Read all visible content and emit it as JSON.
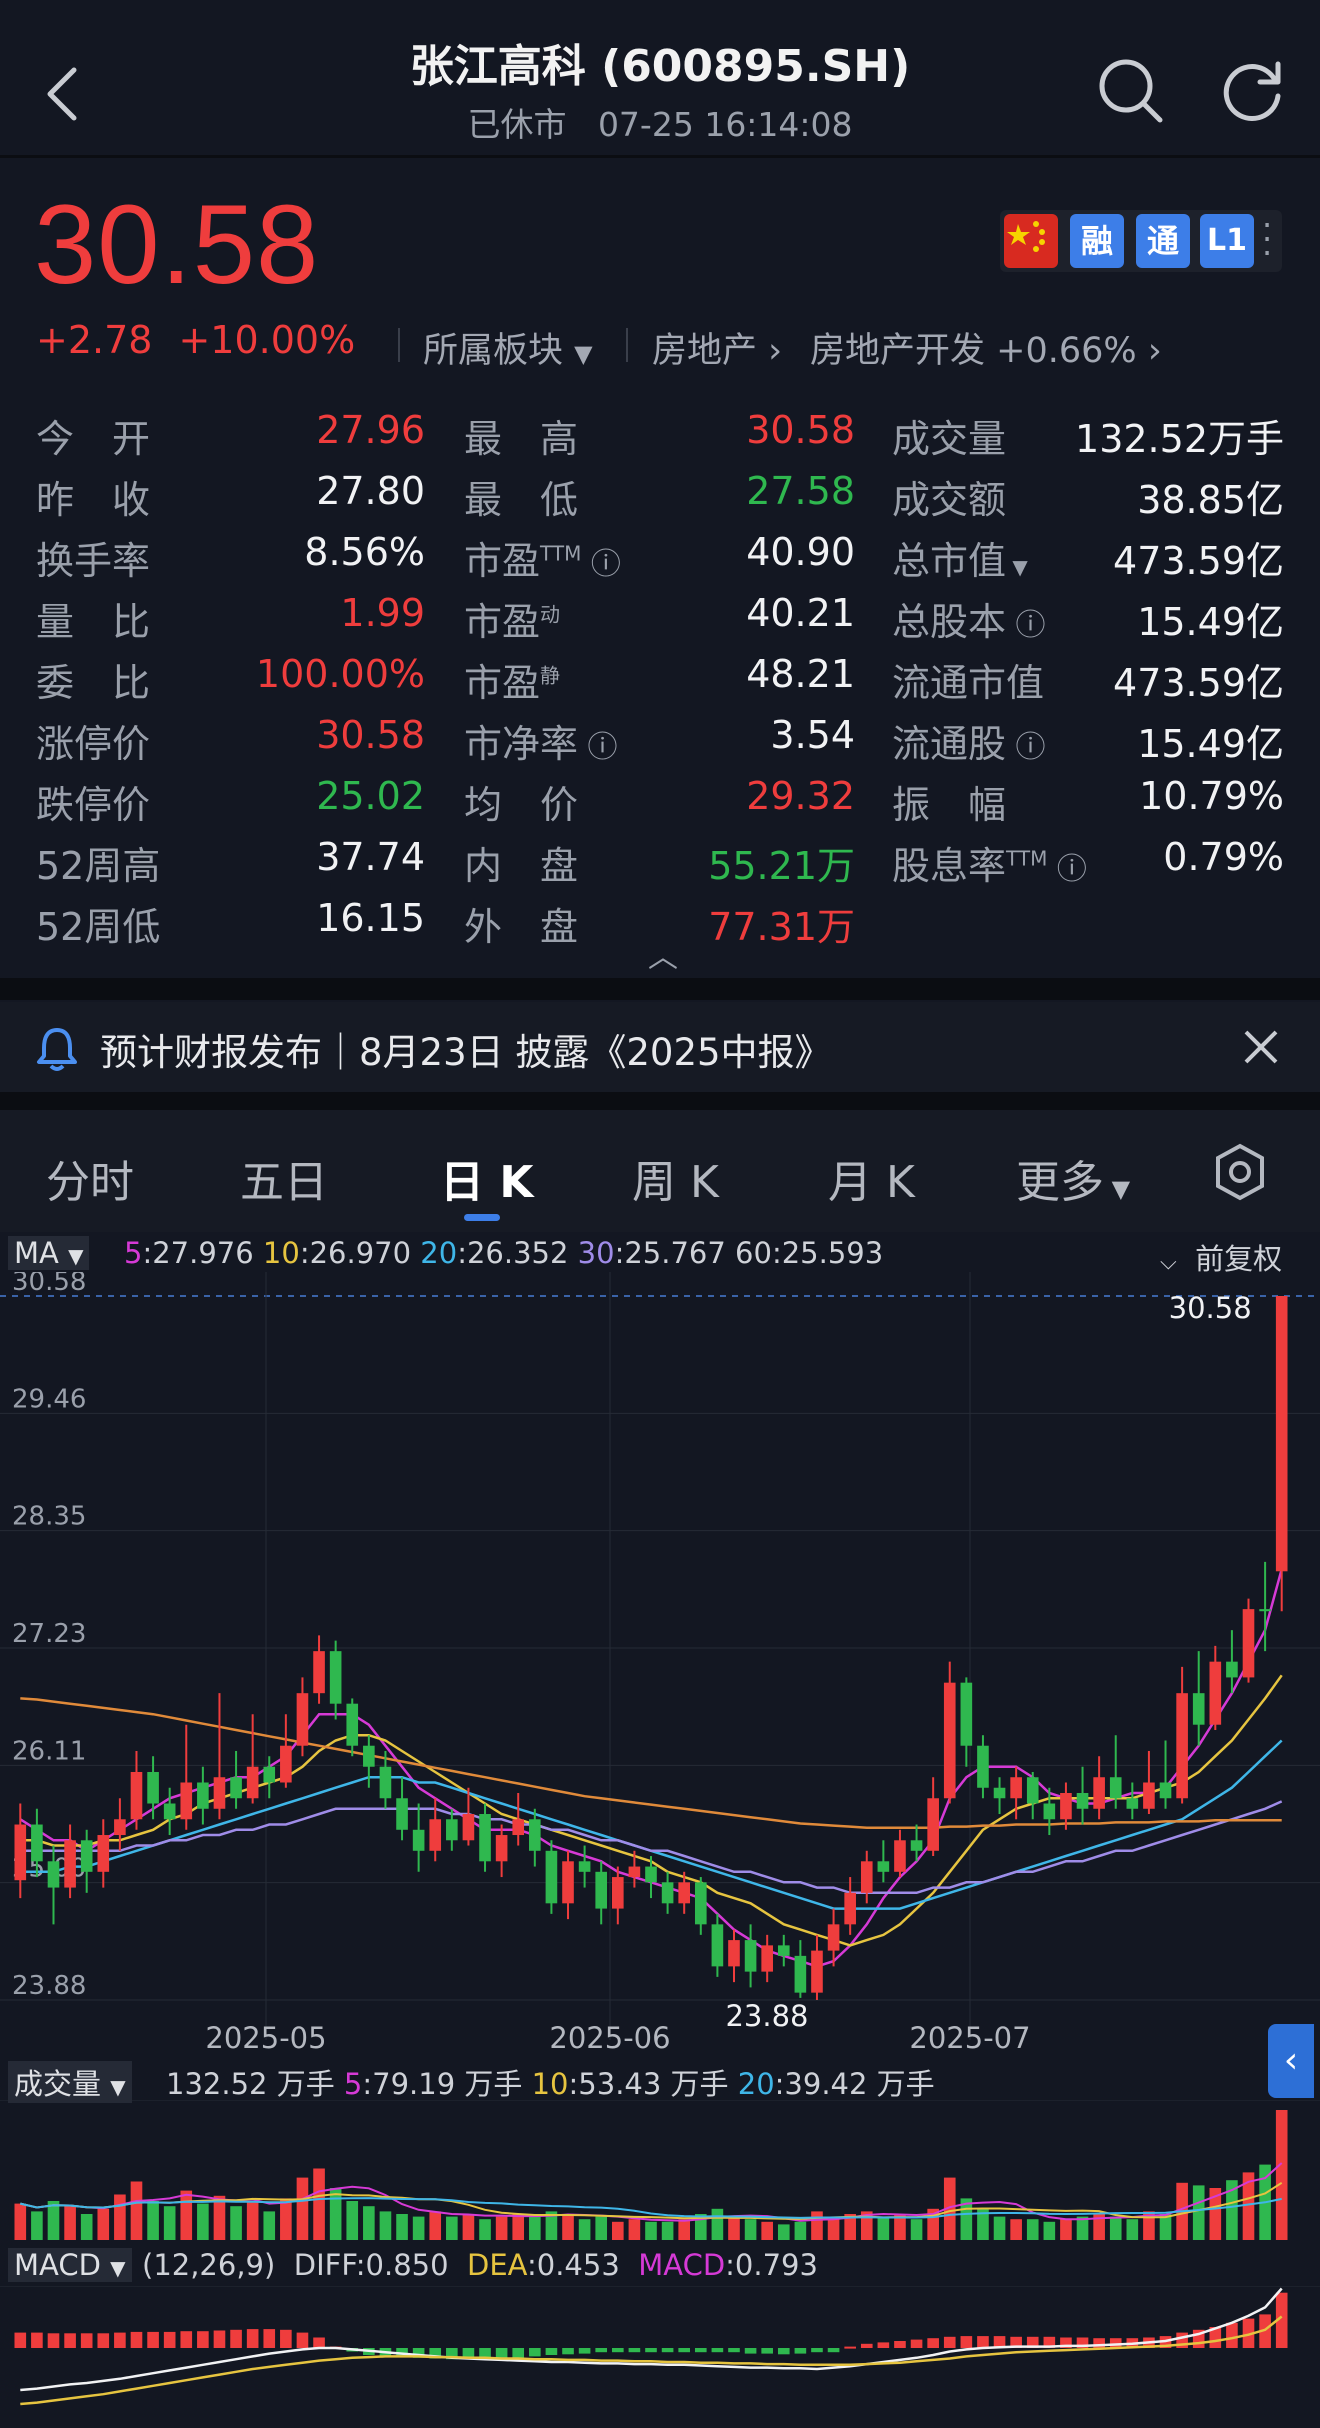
{
  "header": {
    "title": "张江高科 (600895.SH)",
    "status": "已休市",
    "datetime": "07-25 16:14:08",
    "icons": [
      "back-icon",
      "search-icon",
      "refresh-icon"
    ]
  },
  "quote": {
    "price": "30.58",
    "change": "+2.78",
    "change_pct": "+10.00%",
    "badges": [
      "融",
      "通",
      "L1"
    ],
    "sector_label": "所属板块",
    "sector_1": "房地产",
    "sector_2": "房地产开发",
    "sector_2_change": "+0.66%"
  },
  "stats": {
    "col1": [
      {
        "label": "今　开",
        "value": "27.96",
        "color": "red"
      },
      {
        "label": "昨　收",
        "value": "27.80",
        "color": "white"
      },
      {
        "label": "换手率",
        "value": "8.56%",
        "color": "white"
      },
      {
        "label": "量　比",
        "value": "1.99",
        "color": "red"
      },
      {
        "label": "委　比",
        "value": "100.00%",
        "color": "red"
      },
      {
        "label": "涨停价",
        "value": "30.58",
        "color": "red"
      },
      {
        "label": "跌停价",
        "value": "25.02",
        "color": "green"
      },
      {
        "label": "52周高",
        "value": "37.74",
        "color": "white"
      },
      {
        "label": "52周低",
        "value": "16.15",
        "color": "white"
      }
    ],
    "col2": [
      {
        "label": "最　高",
        "sup": "",
        "value": "30.58",
        "color": "red"
      },
      {
        "label": "最　低",
        "sup": "",
        "value": "27.58",
        "color": "green"
      },
      {
        "label": "市盈",
        "sup": "TTM",
        "value": "40.90",
        "color": "white"
      },
      {
        "label": "市盈",
        "sup": "动",
        "value": "40.21",
        "color": "white"
      },
      {
        "label": "市盈",
        "sup": "静",
        "value": "48.21",
        "color": "white"
      },
      {
        "label": "市净率",
        "sup": "",
        "value": "3.54",
        "color": "white"
      },
      {
        "label": "均　价",
        "sup": "",
        "value": "29.32",
        "color": "red"
      },
      {
        "label": "内　盘",
        "sup": "",
        "value": "55.21万",
        "color": "green"
      },
      {
        "label": "外　盘",
        "sup": "",
        "value": "77.31万",
        "color": "red"
      }
    ],
    "col3": [
      {
        "label": "成交量",
        "sup": "",
        "value": "132.52万手"
      },
      {
        "label": "成交额",
        "sup": "",
        "value": "38.85亿"
      },
      {
        "label": "总市值",
        "sup": "",
        "value": "473.59亿"
      },
      {
        "label": "总股本",
        "sup": "",
        "value": "15.49亿"
      },
      {
        "label": "流通市值",
        "sup": "",
        "value": "473.59亿"
      },
      {
        "label": "流通股",
        "sup": "",
        "value": "15.49亿"
      },
      {
        "label": "振　幅",
        "sup": "",
        "value": "10.79%"
      },
      {
        "label": "股息率",
        "sup": "TTM",
        "value": "0.79%"
      }
    ]
  },
  "notice": {
    "text": "预计财报发布｜8月23日 披露《2025中报》"
  },
  "tabs": [
    "分时",
    "五日",
    "日 K",
    "周 K",
    "月 K",
    "更多"
  ],
  "active_tab": "日 K",
  "ma_legend": {
    "label": "MA",
    "items": [
      {
        "key": "5",
        "value": ":27.976",
        "color": "#d63ad6"
      },
      {
        "key": "10",
        "value": ":26.970",
        "color": "#e6c440"
      },
      {
        "key": "20",
        "value": ":26.352",
        "color": "#3fb6e8"
      },
      {
        "key": "30",
        "value": ":25.767",
        "color": "#9f8ce8"
      },
      {
        "key": "60",
        "value": ":25.593",
        "color": "#cfd2d8"
      }
    ],
    "adjust": "前复权"
  },
  "volume_legend": {
    "label": "成交量",
    "total": "132.52 万手",
    "items": [
      {
        "key": "5",
        "value": ":79.19 万手",
        "color": "#d63ad6"
      },
      {
        "key": "10",
        "value": ":53.43 万手",
        "color": "#e6c440"
      },
      {
        "key": "20",
        "value": ":39.42 万手",
        "color": "#3fb6e8"
      }
    ]
  },
  "macd_legend": {
    "label": "MACD",
    "params": "(12,26,9)",
    "diff_label": "DIFF",
    "diff": ":0.850",
    "dea_label": "DEA",
    "dea": ":0.453",
    "macd_label": "MACD",
    "macd": ":0.793"
  },
  "chart_data": {
    "type": "candlestick",
    "y_ticks": [
      "30.58",
      "29.46",
      "28.35",
      "27.23",
      "26.11",
      "25.00",
      "23.88"
    ],
    "ylim": [
      23.88,
      30.58
    ],
    "x_ticks": [
      "2025-05",
      "2025-06",
      "2025-07"
    ],
    "high_label": "30.58",
    "low_label": "23.88",
    "colors": {
      "up": "#ef3d3d",
      "down": "#2fb84f"
    },
    "candles": [
      [
        25.02,
        25.55,
        25.75,
        24.85
      ],
      [
        25.55,
        25.2,
        25.7,
        25.05
      ],
      [
        25.2,
        24.95,
        25.35,
        24.6
      ],
      [
        24.95,
        25.4,
        25.55,
        24.85
      ],
      [
        25.4,
        25.1,
        25.5,
        24.9
      ],
      [
        25.1,
        25.45,
        25.6,
        24.95
      ],
      [
        25.45,
        25.6,
        25.8,
        25.3
      ],
      [
        25.6,
        26.05,
        26.25,
        25.5
      ],
      [
        26.05,
        25.75,
        26.2,
        25.6
      ],
      [
        25.75,
        25.6,
        25.9,
        25.45
      ],
      [
        25.6,
        25.95,
        26.5,
        25.5
      ],
      [
        25.95,
        25.7,
        26.1,
        25.55
      ],
      [
        25.7,
        26.0,
        26.8,
        25.6
      ],
      [
        26.0,
        25.8,
        26.25,
        25.7
      ],
      [
        25.8,
        26.1,
        26.6,
        25.75
      ],
      [
        26.1,
        25.95,
        26.2,
        25.8
      ],
      [
        25.95,
        26.3,
        26.6,
        25.9
      ],
      [
        26.3,
        26.8,
        26.95,
        26.2
      ],
      [
        26.8,
        27.2,
        27.35,
        26.7
      ],
      [
        27.2,
        26.7,
        27.3,
        26.55
      ],
      [
        26.7,
        26.3,
        26.75,
        26.2
      ],
      [
        26.3,
        26.1,
        26.4,
        25.9
      ],
      [
        26.1,
        25.8,
        26.25,
        25.7
      ],
      [
        25.8,
        25.5,
        26.0,
        25.4
      ],
      [
        25.5,
        25.3,
        25.75,
        25.1
      ],
      [
        25.3,
        25.6,
        25.8,
        25.2
      ],
      [
        25.6,
        25.4,
        25.7,
        25.3
      ],
      [
        25.4,
        25.65,
        25.9,
        25.35
      ],
      [
        25.65,
        25.2,
        25.75,
        25.1
      ],
      [
        25.2,
        25.45,
        25.55,
        25.05
      ],
      [
        25.45,
        25.6,
        25.85,
        25.35
      ],
      [
        25.6,
        25.3,
        25.7,
        25.15
      ],
      [
        25.3,
        24.8,
        25.4,
        24.7
      ],
      [
        24.8,
        25.2,
        25.3,
        24.65
      ],
      [
        25.2,
        25.1,
        25.35,
        24.95
      ],
      [
        25.1,
        24.75,
        25.2,
        24.6
      ],
      [
        24.75,
        25.05,
        25.15,
        24.6
      ],
      [
        25.05,
        25.15,
        25.3,
        24.95
      ],
      [
        25.15,
        25.0,
        25.25,
        24.85
      ],
      [
        25.0,
        24.8,
        25.1,
        24.7
      ],
      [
        24.8,
        25.0,
        25.1,
        24.7
      ],
      [
        25.0,
        24.6,
        25.05,
        24.5
      ],
      [
        24.6,
        24.2,
        24.7,
        24.1
      ],
      [
        24.2,
        24.45,
        24.55,
        24.05
      ],
      [
        24.45,
        24.15,
        24.6,
        24.0
      ],
      [
        24.15,
        24.4,
        24.5,
        24.05
      ],
      [
        24.4,
        24.3,
        24.5,
        24.2
      ],
      [
        24.3,
        23.95,
        24.45,
        23.9
      ],
      [
        23.95,
        24.35,
        24.5,
        23.88
      ],
      [
        24.35,
        24.6,
        24.75,
        24.2
      ],
      [
        24.6,
        24.9,
        25.05,
        24.5
      ],
      [
        24.9,
        25.2,
        25.3,
        24.8
      ],
      [
        25.2,
        25.1,
        25.4,
        25.0
      ],
      [
        25.1,
        25.4,
        25.5,
        25.05
      ],
      [
        25.4,
        25.3,
        25.55,
        25.2
      ],
      [
        25.3,
        25.8,
        26.0,
        25.25
      ],
      [
        25.8,
        26.9,
        27.1,
        25.75
      ],
      [
        26.9,
        26.3,
        26.95,
        26.1
      ],
      [
        26.3,
        25.9,
        26.4,
        25.8
      ],
      [
        25.9,
        25.8,
        26.0,
        25.65
      ],
      [
        25.8,
        26.0,
        26.1,
        25.6
      ],
      [
        26.0,
        25.75,
        26.05,
        25.6
      ],
      [
        25.75,
        25.6,
        25.9,
        25.45
      ],
      [
        25.6,
        25.85,
        25.95,
        25.5
      ],
      [
        25.85,
        25.7,
        26.1,
        25.55
      ],
      [
        25.7,
        26.0,
        26.2,
        25.6
      ],
      [
        26.0,
        25.8,
        26.4,
        25.7
      ],
      [
        25.8,
        25.7,
        25.95,
        25.6
      ],
      [
        25.7,
        25.95,
        26.25,
        25.65
      ],
      [
        25.95,
        25.8,
        26.35,
        25.7
      ],
      [
        25.8,
        26.8,
        27.05,
        25.75
      ],
      [
        26.8,
        26.5,
        27.2,
        26.3
      ],
      [
        26.5,
        27.1,
        27.25,
        26.45
      ],
      [
        27.1,
        26.95,
        27.4,
        26.8
      ],
      [
        26.95,
        27.6,
        27.7,
        26.9
      ],
      [
        27.6,
        27.58,
        28.05,
        27.2
      ],
      [
        27.96,
        30.58,
        30.58,
        27.58
      ]
    ],
    "ma": {
      "5": [
        25.6,
        25.5,
        25.4,
        25.4,
        25.3,
        25.4,
        25.5,
        25.6,
        25.7,
        25.8,
        25.85,
        25.9,
        25.95,
        26.0,
        26.0,
        26.1,
        26.2,
        26.4,
        26.6,
        26.6,
        26.6,
        26.5,
        26.3,
        26.1,
        25.9,
        25.8,
        25.7,
        25.6,
        25.5,
        25.5,
        25.5,
        25.45,
        25.35,
        25.3,
        25.25,
        25.2,
        25.1,
        25.05,
        25.0,
        24.95,
        24.9,
        24.85,
        24.7,
        24.55,
        24.45,
        24.35,
        24.3,
        24.25,
        24.2,
        24.25,
        24.4,
        24.6,
        24.85,
        25.05,
        25.2,
        25.4,
        25.8,
        26.0,
        26.1,
        26.1,
        26.1,
        26.0,
        25.85,
        25.8,
        25.75,
        25.75,
        25.8,
        25.85,
        25.85,
        25.9,
        26.1,
        26.3,
        26.55,
        26.8,
        27.1,
        27.4,
        27.98
      ],
      "10": [
        25.4,
        25.4,
        25.35,
        25.35,
        25.35,
        25.4,
        25.4,
        25.45,
        25.5,
        25.6,
        25.65,
        25.75,
        25.8,
        25.85,
        25.9,
        25.95,
        26.0,
        26.1,
        26.25,
        26.35,
        26.4,
        26.4,
        26.35,
        26.25,
        26.15,
        26.05,
        25.95,
        25.85,
        25.75,
        25.65,
        25.6,
        25.55,
        25.5,
        25.45,
        25.4,
        25.35,
        25.3,
        25.25,
        25.2,
        25.1,
        25.05,
        25.0,
        24.9,
        24.85,
        24.8,
        24.7,
        24.6,
        24.55,
        24.5,
        24.45,
        24.4,
        24.45,
        24.5,
        24.6,
        24.75,
        24.9,
        25.1,
        25.3,
        25.5,
        25.6,
        25.7,
        25.75,
        25.8,
        25.8,
        25.8,
        25.8,
        25.8,
        25.8,
        25.85,
        25.9,
        25.95,
        26.05,
        26.2,
        26.35,
        26.55,
        26.75,
        26.97
      ],
      "20": [
        25.1,
        25.1,
        25.1,
        25.15,
        25.15,
        25.2,
        25.25,
        25.3,
        25.35,
        25.4,
        25.45,
        25.5,
        25.55,
        25.6,
        25.65,
        25.7,
        25.75,
        25.8,
        25.85,
        25.9,
        25.95,
        26.0,
        26.0,
        26.0,
        25.95,
        25.95,
        25.9,
        25.85,
        25.8,
        25.75,
        25.7,
        25.65,
        25.6,
        25.55,
        25.5,
        25.45,
        25.4,
        25.35,
        25.3,
        25.25,
        25.2,
        25.15,
        25.1,
        25.05,
        25.0,
        24.95,
        24.9,
        24.85,
        24.8,
        24.75,
        24.75,
        24.75,
        24.75,
        24.75,
        24.8,
        24.85,
        24.9,
        24.95,
        25.0,
        25.05,
        25.1,
        25.15,
        25.2,
        25.25,
        25.3,
        25.35,
        25.4,
        25.45,
        25.5,
        25.55,
        25.6,
        25.7,
        25.8,
        25.9,
        26.05,
        26.2,
        26.35
      ],
      "30": [
        25.3,
        25.3,
        25.3,
        25.3,
        25.3,
        25.3,
        25.3,
        25.35,
        25.35,
        25.4,
        25.4,
        25.45,
        25.45,
        25.5,
        25.5,
        25.55,
        25.55,
        25.6,
        25.65,
        25.7,
        25.7,
        25.7,
        25.7,
        25.7,
        25.7,
        25.7,
        25.65,
        25.65,
        25.6,
        25.6,
        25.55,
        25.55,
        25.5,
        25.5,
        25.45,
        25.4,
        25.4,
        25.35,
        25.3,
        25.3,
        25.25,
        25.2,
        25.15,
        25.1,
        25.1,
        25.05,
        25.0,
        25.0,
        24.95,
        24.95,
        24.9,
        24.9,
        24.9,
        24.9,
        24.9,
        24.95,
        24.95,
        25.0,
        25.0,
        25.05,
        25.1,
        25.1,
        25.15,
        25.2,
        25.2,
        25.25,
        25.3,
        25.3,
        25.35,
        25.4,
        25.45,
        25.5,
        25.55,
        25.6,
        25.65,
        25.7,
        25.77
      ],
      "60": [
        26.75,
        26.74,
        26.72,
        26.7,
        26.68,
        26.66,
        26.64,
        26.62,
        26.6,
        26.57,
        26.54,
        26.51,
        26.48,
        26.45,
        26.42,
        26.39,
        26.36,
        26.33,
        26.3,
        26.27,
        26.24,
        26.21,
        26.18,
        26.15,
        26.12,
        26.09,
        26.06,
        26.03,
        26.0,
        25.97,
        25.94,
        25.91,
        25.88,
        25.85,
        25.82,
        25.8,
        25.78,
        25.76,
        25.74,
        25.72,
        25.7,
        25.68,
        25.66,
        25.64,
        25.62,
        25.6,
        25.58,
        25.56,
        25.55,
        25.54,
        25.53,
        25.52,
        25.52,
        25.52,
        25.52,
        25.52,
        25.53,
        25.53,
        25.54,
        25.54,
        25.55,
        25.55,
        25.55,
        25.56,
        25.56,
        25.56,
        25.57,
        25.57,
        25.57,
        25.58,
        25.58,
        25.58,
        25.59,
        25.59,
        25.59,
        25.59,
        25.59
      ]
    },
    "volume": [
      28,
      22,
      30,
      26,
      20,
      24,
      35,
      45,
      30,
      26,
      38,
      28,
      34,
      26,
      30,
      22,
      32,
      48,
      55,
      40,
      30,
      26,
      22,
      20,
      18,
      22,
      18,
      20,
      16,
      18,
      20,
      18,
      22,
      20,
      16,
      18,
      14,
      16,
      14,
      14,
      16,
      20,
      24,
      18,
      16,
      14,
      12,
      14,
      22,
      18,
      20,
      22,
      18,
      20,
      16,
      24,
      48,
      32,
      24,
      18,
      16,
      16,
      14,
      16,
      18,
      20,
      18,
      16,
      22,
      20,
      44,
      42,
      40,
      46,
      52,
      58,
      100
    ],
    "macd_hist": [
      0.22,
      0.22,
      0.21,
      0.21,
      0.21,
      0.21,
      0.22,
      0.23,
      0.23,
      0.23,
      0.24,
      0.24,
      0.25,
      0.26,
      0.27,
      0.27,
      0.26,
      0.22,
      0.15,
      0.02,
      -0.05,
      -0.1,
      -0.12,
      -0.13,
      -0.14,
      -0.15,
      -0.16,
      -0.16,
      -0.16,
      -0.15,
      -0.14,
      -0.12,
      -0.1,
      -0.09,
      -0.08,
      -0.06,
      -0.06,
      -0.06,
      -0.06,
      -0.06,
      -0.06,
      -0.06,
      -0.06,
      -0.06,
      -0.08,
      -0.08,
      -0.09,
      -0.08,
      -0.06,
      -0.06,
      0.02,
      0.06,
      0.08,
      0.1,
      0.12,
      0.14,
      0.16,
      0.17,
      0.17,
      0.17,
      0.16,
      0.16,
      0.16,
      0.15,
      0.15,
      0.14,
      0.14,
      0.14,
      0.15,
      0.17,
      0.22,
      0.26,
      0.3,
      0.36,
      0.42,
      0.48,
      0.79
    ],
    "macd_diff": [
      -0.6,
      -0.58,
      -0.55,
      -0.52,
      -0.5,
      -0.47,
      -0.44,
      -0.4,
      -0.36,
      -0.32,
      -0.28,
      -0.24,
      -0.2,
      -0.16,
      -0.12,
      -0.08,
      -0.05,
      -0.02,
      0.0,
      0.0,
      -0.02,
      -0.04,
      -0.06,
      -0.08,
      -0.1,
      -0.12,
      -0.14,
      -0.15,
      -0.16,
      -0.17,
      -0.18,
      -0.19,
      -0.2,
      -0.2,
      -0.21,
      -0.22,
      -0.22,
      -0.23,
      -0.23,
      -0.24,
      -0.24,
      -0.25,
      -0.26,
      -0.27,
      -0.28,
      -0.28,
      -0.29,
      -0.29,
      -0.3,
      -0.28,
      -0.26,
      -0.23,
      -0.2,
      -0.17,
      -0.14,
      -0.1,
      -0.05,
      -0.02,
      0.0,
      0.01,
      0.02,
      0.02,
      0.02,
      0.03,
      0.03,
      0.04,
      0.05,
      0.06,
      0.08,
      0.1,
      0.15,
      0.2,
      0.28,
      0.36,
      0.46,
      0.58,
      0.85
    ],
    "macd_dea": [
      -0.8,
      -0.78,
      -0.75,
      -0.72,
      -0.69,
      -0.66,
      -0.62,
      -0.58,
      -0.54,
      -0.5,
      -0.46,
      -0.42,
      -0.38,
      -0.34,
      -0.3,
      -0.27,
      -0.24,
      -0.21,
      -0.18,
      -0.16,
      -0.14,
      -0.13,
      -0.12,
      -0.12,
      -0.12,
      -0.13,
      -0.13,
      -0.14,
      -0.14,
      -0.15,
      -0.15,
      -0.16,
      -0.16,
      -0.17,
      -0.17,
      -0.18,
      -0.18,
      -0.19,
      -0.19,
      -0.2,
      -0.2,
      -0.21,
      -0.21,
      -0.22,
      -0.22,
      -0.23,
      -0.23,
      -0.24,
      -0.24,
      -0.24,
      -0.24,
      -0.23,
      -0.22,
      -0.21,
      -0.19,
      -0.17,
      -0.15,
      -0.12,
      -0.1,
      -0.08,
      -0.06,
      -0.05,
      -0.04,
      -0.03,
      -0.02,
      -0.01,
      0.0,
      0.01,
      0.02,
      0.03,
      0.05,
      0.07,
      0.1,
      0.14,
      0.19,
      0.26,
      0.45
    ]
  }
}
